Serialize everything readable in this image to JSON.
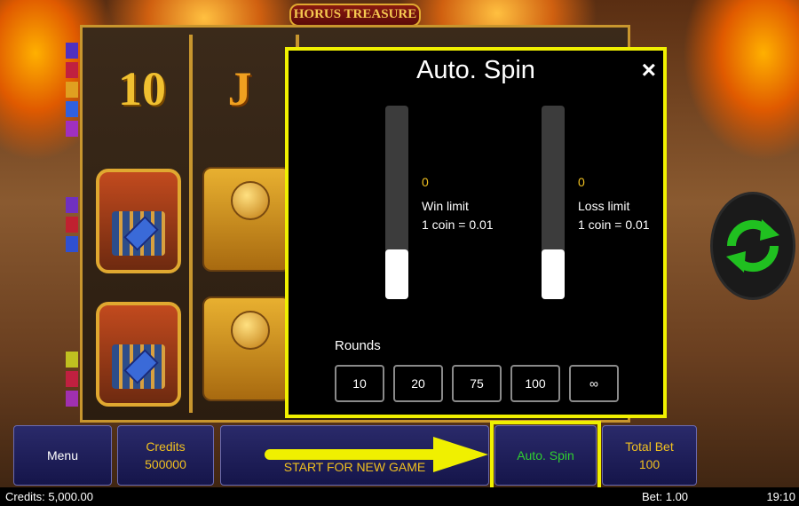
{
  "game": {
    "logo_text": "HORUS TREASURE"
  },
  "reels": {
    "symbols": {
      "ten": "10",
      "jack": "J"
    }
  },
  "autospin_dialog": {
    "title": "Auto. Spin",
    "close_label": "×",
    "win_limit": {
      "value": "0",
      "label": "Win limit",
      "note": "1 coin = 0.01",
      "level": 0
    },
    "loss_limit": {
      "value": "0",
      "label": "Loss limit",
      "note": "1 coin = 0.01",
      "level": 0
    },
    "rounds_label": "Rounds",
    "rounds_options": [
      "10",
      "20",
      "75",
      "100",
      "∞"
    ]
  },
  "bottom_bar": {
    "menu_label": "Menu",
    "credits_label": "Credits",
    "credits_value": "500000",
    "start_label": "START FOR NEW GAME",
    "autospin_label": "Auto. Spin",
    "total_bet_label": "Total Bet",
    "total_bet_value": "100"
  },
  "status_bar": {
    "credits": "Credits: 5,000.00",
    "bet": "Bet: 1.00",
    "time": "19:10"
  },
  "colors": {
    "highlight": "#f0f000",
    "accent_gold": "#f0c020",
    "spin_green": "#30d030"
  },
  "icons": {
    "spin_button": "refresh-arrows-icon",
    "close": "close-icon",
    "pointer": "arrow-right-icon"
  }
}
